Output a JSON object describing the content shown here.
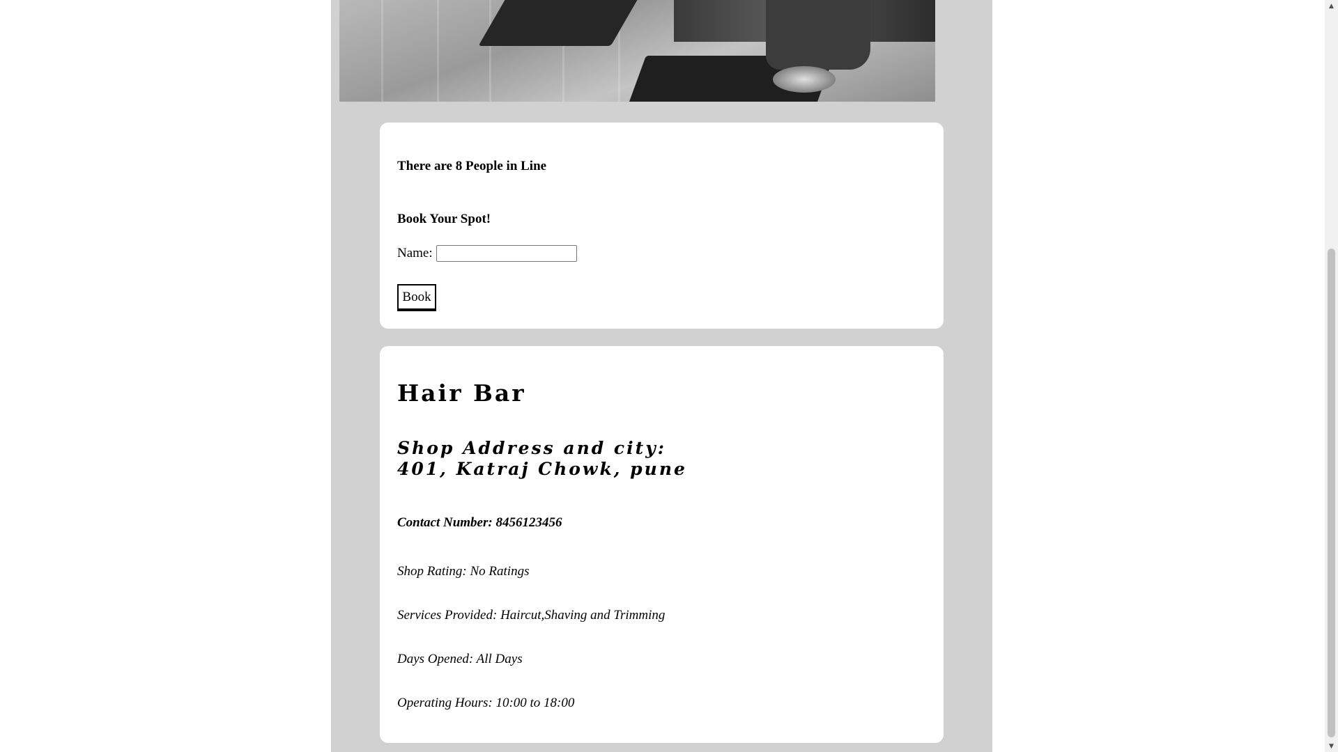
{
  "queue": {
    "people_in_line_text": "There are 8 People in Line"
  },
  "booking": {
    "heading": "Book Your Spot!",
    "name_label": "Name:",
    "name_value": "",
    "book_button_label": "Book"
  },
  "shop": {
    "name": "Hair Bar",
    "address_label": "Shop Address and city:",
    "address_value": "401, Katraj Chowk, pune",
    "contact": "Contact Number: 8456123456",
    "rating": "Shop Rating: No Ratings",
    "services": "Services Provided: Haircut,Shaving and Trimming",
    "days_opened": "Days Opened: All Days",
    "operating_hours": "Operating Hours: 10:00 to 18:00"
  },
  "icons": {
    "scroll_up": "scroll-up-arrow-icon",
    "scroll_down": "scroll-down-arrow-icon"
  },
  "colors": {
    "page_background": "#ffffff",
    "column_background": "#d1d1d1",
    "card_background": "#ffffff"
  }
}
